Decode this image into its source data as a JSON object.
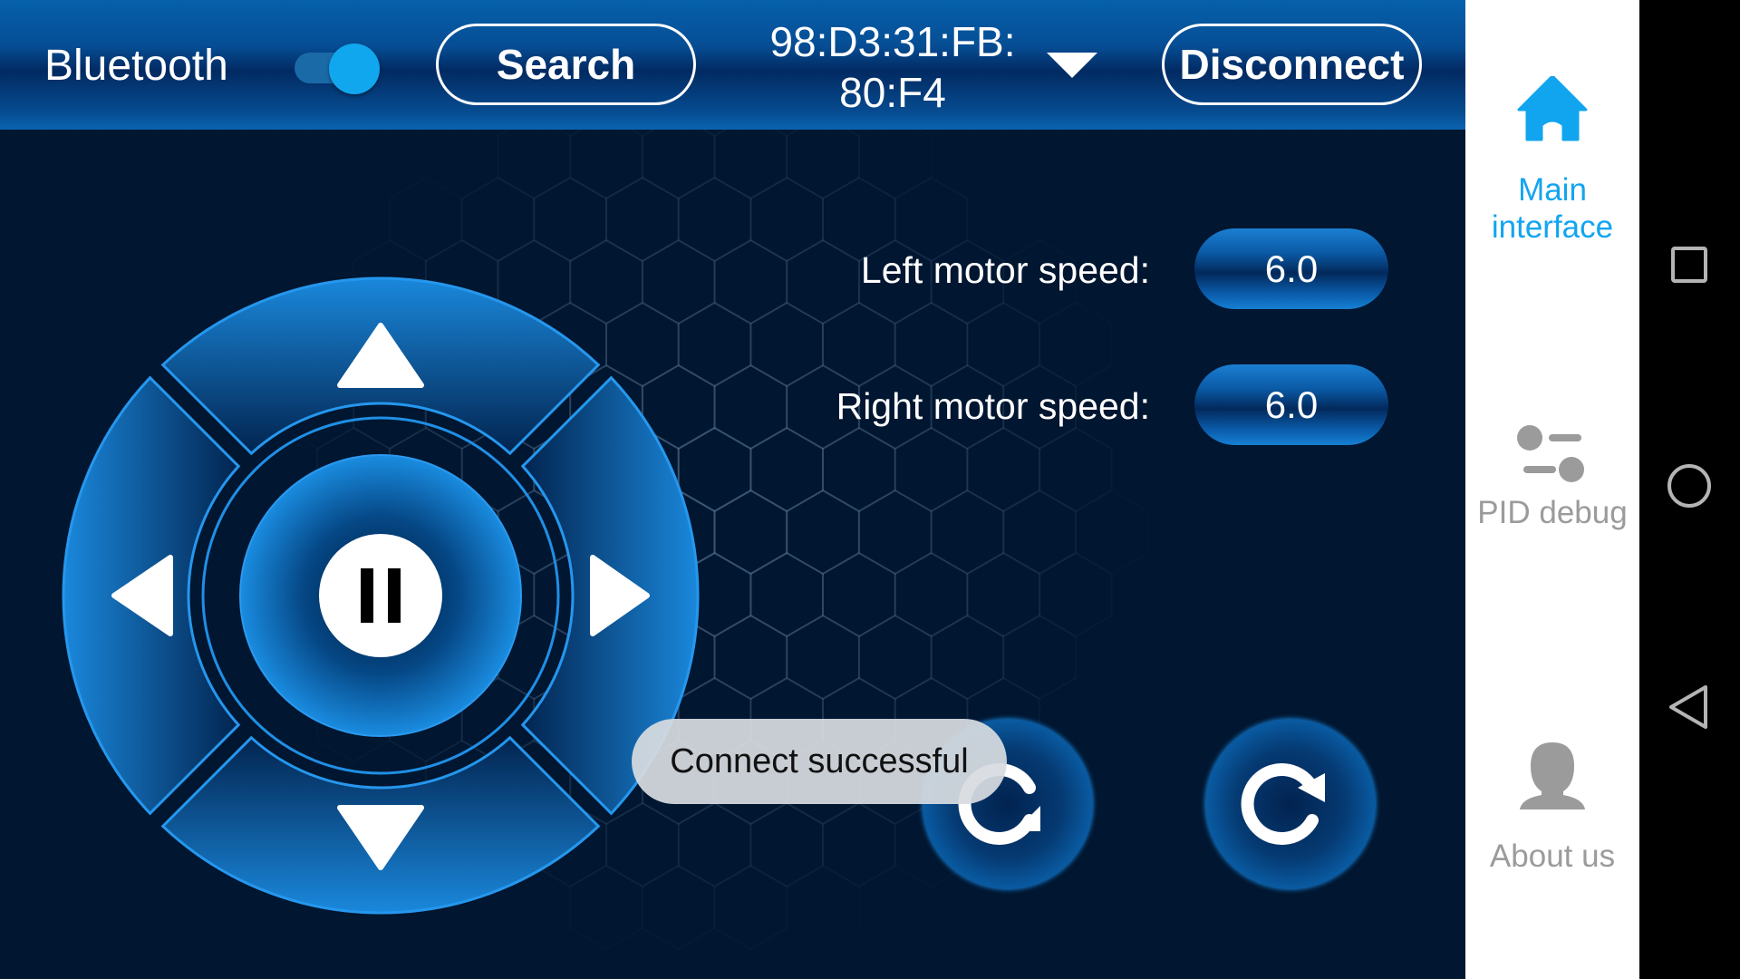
{
  "header": {
    "bluetooth_label": "Bluetooth",
    "bluetooth_enabled": true,
    "search_label": "Search",
    "device_address_line1": "98:D3:31:FB:",
    "device_address_line2": "80:F4",
    "disconnect_label": "Disconnect"
  },
  "motors": {
    "left_label": "Left motor speed:",
    "left_value": "6.0",
    "right_label": "Right motor speed:",
    "right_value": "6.0"
  },
  "controls": {
    "up_icon": "arrow-up-icon",
    "down_icon": "arrow-down-icon",
    "left_icon": "arrow-left-icon",
    "right_icon": "arrow-right-icon",
    "center_icon": "pause-icon",
    "rotate_left_icon": "rotate-counterclockwise-icon",
    "rotate_right_icon": "rotate-clockwise-icon"
  },
  "toast": {
    "message": "Connect successful"
  },
  "sidebar": {
    "items": [
      {
        "label": "Main\ninterface",
        "line1": "Main",
        "line2": "interface",
        "icon": "home-icon",
        "active": true
      },
      {
        "label": "PID debug",
        "icon": "sliders-icon",
        "active": false
      },
      {
        "label": "About us",
        "icon": "user-icon",
        "active": false
      }
    ]
  },
  "colors": {
    "accent": "#12a5ef",
    "inactive": "#9b9b9b",
    "background": "#011630",
    "header_blue": "#064e95"
  },
  "navbar": {
    "buttons": [
      "recent-apps-icon",
      "home-circle-icon",
      "back-icon"
    ]
  }
}
